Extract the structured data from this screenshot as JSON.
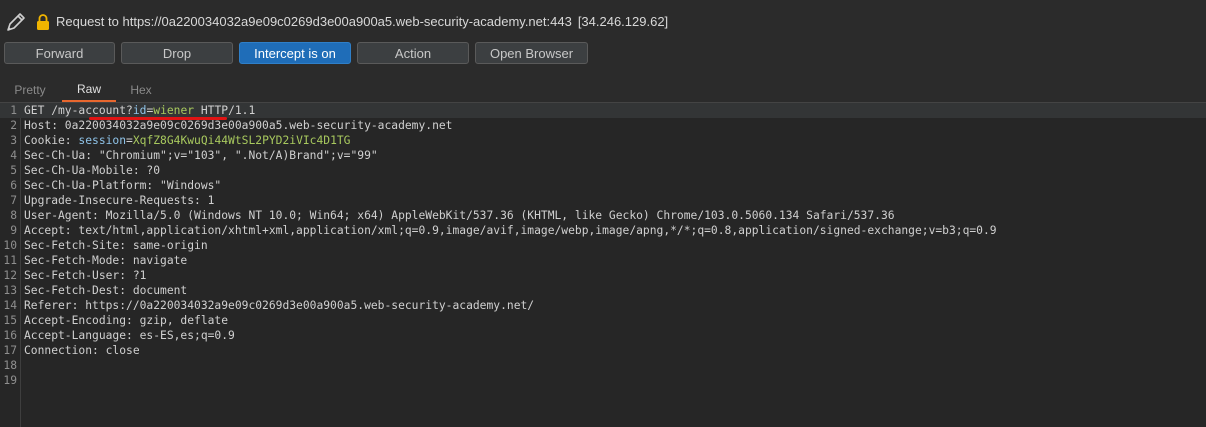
{
  "header": {
    "request_label": "Request to https://0a220034032a9e09c0269d3e00a900a5.web-security-academy.net:443",
    "ip": "[34.246.129.62]"
  },
  "toolbar": {
    "forward": "Forward",
    "drop": "Drop",
    "intercept": "Intercept is on",
    "action": "Action",
    "open_browser": "Open Browser"
  },
  "tabs": {
    "pretty": "Pretty",
    "raw": "Raw",
    "hex": "Hex"
  },
  "colors": {
    "accent_button": "#1f6db8",
    "tab_underline": "#e8672e",
    "annotation": "#e01414"
  },
  "request": {
    "lines": [
      {
        "n": "1",
        "parts": [
          {
            "t": "GET /my-account",
            "c": "hname"
          },
          {
            "t": "?",
            "c": "hname"
          },
          {
            "t": "id",
            "c": "pname"
          },
          {
            "t": "=",
            "c": "hname"
          },
          {
            "t": "wiener",
            "c": "pval"
          },
          {
            "t": " HTTP/1.1",
            "c": "hname"
          }
        ]
      },
      {
        "n": "2",
        "parts": [
          {
            "t": "Host: 0a220034032a9e09c0269d3e00a900a5.web-security-academy.net",
            "c": "hname"
          }
        ]
      },
      {
        "n": "3",
        "parts": [
          {
            "t": "Cookie: ",
            "c": "hname"
          },
          {
            "t": "session",
            "c": "pname"
          },
          {
            "t": "=",
            "c": "hname"
          },
          {
            "t": "XqfZ8G4KwuQi44WtSL2PYD2iVIc4D1TG",
            "c": "pval"
          }
        ]
      },
      {
        "n": "4",
        "parts": [
          {
            "t": "Sec-Ch-Ua: \"Chromium\";v=\"103\", \".Not/A)Brand\";v=\"99\"",
            "c": "hname"
          }
        ]
      },
      {
        "n": "5",
        "parts": [
          {
            "t": "Sec-Ch-Ua-Mobile: ?0",
            "c": "hname"
          }
        ]
      },
      {
        "n": "6",
        "parts": [
          {
            "t": "Sec-Ch-Ua-Platform: \"Windows\"",
            "c": "hname"
          }
        ]
      },
      {
        "n": "7",
        "parts": [
          {
            "t": "Upgrade-Insecure-Requests: 1",
            "c": "hname"
          }
        ]
      },
      {
        "n": "8",
        "parts": [
          {
            "t": "User-Agent: Mozilla/5.0 (Windows NT 10.0; Win64; x64) AppleWebKit/537.36 (KHTML, like Gecko) Chrome/103.0.5060.134 Safari/537.36",
            "c": "hname"
          }
        ]
      },
      {
        "n": "9",
        "parts": [
          {
            "t": "Accept: text/html,application/xhtml+xml,application/xml;q=0.9,image/avif,image/webp,image/apng,*/*;q=0.8,application/signed-exchange;v=b3;q=0.9",
            "c": "hname"
          }
        ]
      },
      {
        "n": "10",
        "parts": [
          {
            "t": "Sec-Fetch-Site: same-origin",
            "c": "hname"
          }
        ]
      },
      {
        "n": "11",
        "parts": [
          {
            "t": "Sec-Fetch-Mode: navigate",
            "c": "hname"
          }
        ]
      },
      {
        "n": "12",
        "parts": [
          {
            "t": "Sec-Fetch-User: ?1",
            "c": "hname"
          }
        ]
      },
      {
        "n": "13",
        "parts": [
          {
            "t": "Sec-Fetch-Dest: document",
            "c": "hname"
          }
        ]
      },
      {
        "n": "14",
        "parts": [
          {
            "t": "Referer: https://0a220034032a9e09c0269d3e00a900a5.web-security-academy.net/",
            "c": "hname"
          }
        ]
      },
      {
        "n": "15",
        "parts": [
          {
            "t": "Accept-Encoding: gzip, deflate",
            "c": "hname"
          }
        ]
      },
      {
        "n": "16",
        "parts": [
          {
            "t": "Accept-Language: es-ES,es;q=0.9",
            "c": "hname"
          }
        ]
      },
      {
        "n": "17",
        "parts": [
          {
            "t": "Connection: close",
            "c": "hname"
          }
        ]
      },
      {
        "n": "18",
        "parts": []
      },
      {
        "n": "19",
        "parts": []
      }
    ]
  }
}
